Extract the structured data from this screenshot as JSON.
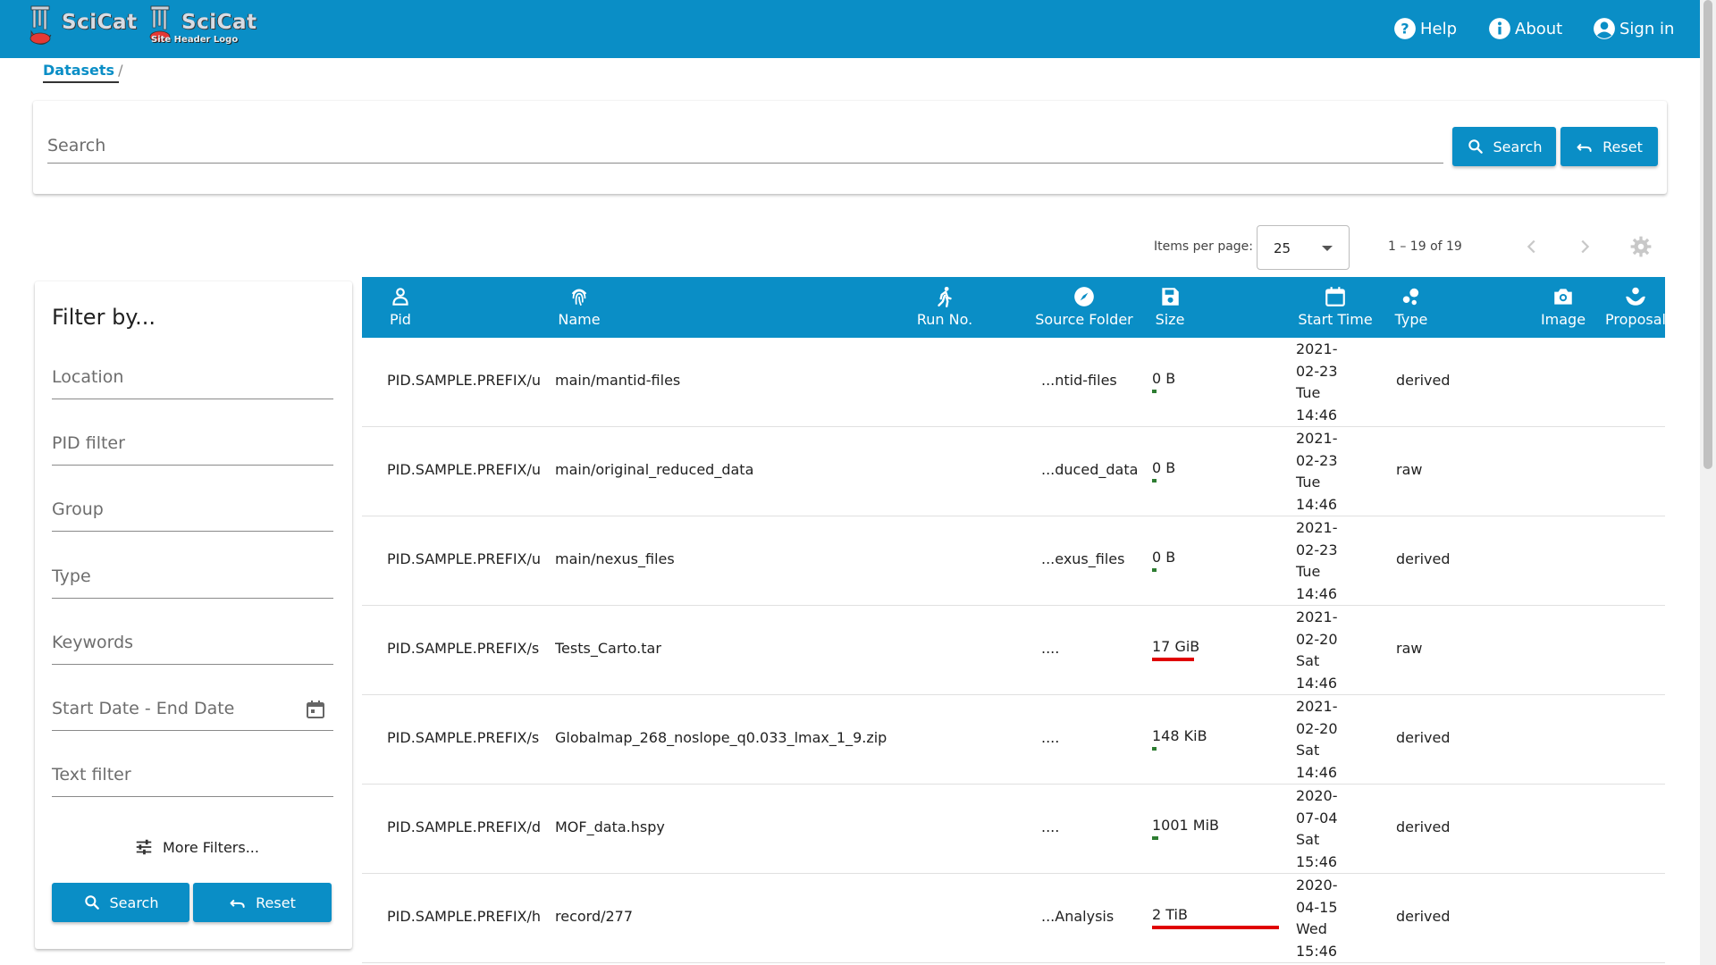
{
  "header": {
    "logo_text": "SciCat",
    "logo2_text": "SciCat",
    "logo2_sub": "Site Header Logo",
    "help_label": "Help",
    "about_label": "About",
    "signin_label": "Sign in",
    "color": "#0a8ec6"
  },
  "breadcrumb": {
    "label": "Datasets",
    "separator": "/"
  },
  "search": {
    "placeholder": "Search",
    "search_label": "Search",
    "reset_label": "Reset"
  },
  "paginator": {
    "items_per_page_label": "Items per page:",
    "items_per_page": "25",
    "range": "1 – 19 of 19"
  },
  "filters": {
    "title": "Filter by...",
    "fields": [
      "Location",
      "PID filter",
      "Group",
      "Type",
      "Keywords",
      "Start Date - End Date",
      "Text filter"
    ],
    "more_label": "More Filters...",
    "search_label": "Search",
    "reset_label": "Reset"
  },
  "table": {
    "columns": [
      {
        "label": "Pid",
        "icon": "person-icon"
      },
      {
        "label": "Name",
        "icon": "fingerprint-icon"
      },
      {
        "label": "Run No.",
        "icon": "run-icon"
      },
      {
        "label": "Source Folder",
        "icon": "compass-icon"
      },
      {
        "label": "Size",
        "icon": "save-icon"
      },
      {
        "label": "Start Time",
        "icon": "calendar-icon"
      },
      {
        "label": "Type",
        "icon": "bubbles-icon"
      },
      {
        "label": "Image",
        "icon": "camera-icon"
      },
      {
        "label": "Proposal",
        "icon": "hand-icon"
      }
    ],
    "rows": [
      {
        "pid": "PID.SAMPLE.PREFIX/u",
        "name": "main/mantid-files",
        "folder": "...ntid-files",
        "size": "0 B",
        "size_fraction": 0.02,
        "size_color": "#2e7d32",
        "time": [
          "2021-",
          "02-23",
          "Tue",
          "14:46"
        ],
        "type": "derived"
      },
      {
        "pid": "PID.SAMPLE.PREFIX/u",
        "name": "main/original_reduced_data",
        "folder": "...duced_data",
        "size": "0 B",
        "size_fraction": 0.02,
        "size_color": "#2e7d32",
        "time": [
          "2021-",
          "02-23",
          "Tue",
          "14:46"
        ],
        "type": "raw"
      },
      {
        "pid": "PID.SAMPLE.PREFIX/u",
        "name": "main/nexus_files",
        "folder": "...exus_files",
        "size": "0 B",
        "size_fraction": 0.02,
        "size_color": "#2e7d32",
        "time": [
          "2021-",
          "02-23",
          "Tue",
          "14:46"
        ],
        "type": "derived"
      },
      {
        "pid": "PID.SAMPLE.PREFIX/s",
        "name": "Tests_Carto.tar",
        "folder": "....",
        "size": "17 GiB",
        "size_fraction": 0.33,
        "size_color": "#e00000",
        "time": [
          "2021-",
          "02-20",
          "Sat",
          "14:46"
        ],
        "type": "raw"
      },
      {
        "pid": "PID.SAMPLE.PREFIX/s",
        "name": "Globalmap_268_noslope_q0.033_lmax_1_9.zip",
        "folder": "....",
        "size": "148 KiB",
        "size_fraction": 0.02,
        "size_color": "#2e7d32",
        "time": [
          "2021-",
          "02-20",
          "Sat",
          "14:46"
        ],
        "type": "derived"
      },
      {
        "pid": "PID.SAMPLE.PREFIX/d",
        "name": "MOF_data.hspy",
        "folder": "....",
        "size": "1001 MiB",
        "size_fraction": 0.05,
        "size_color": "#2e7d32",
        "time": [
          "2020-",
          "07-04",
          "Sat",
          "15:46"
        ],
        "type": "derived"
      },
      {
        "pid": "PID.SAMPLE.PREFIX/h",
        "name": "record/277",
        "folder": "...Analysis",
        "size": "2 TiB",
        "size_fraction": 1.0,
        "size_color": "#e00000",
        "time": [
          "2020-",
          "04-15",
          "Wed",
          "15:46"
        ],
        "type": "derived"
      }
    ]
  }
}
